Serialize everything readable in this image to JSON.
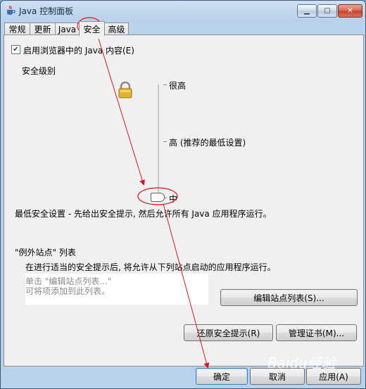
{
  "window": {
    "title": "Java 控制面板"
  },
  "tabs": [
    {
      "label": "常规"
    },
    {
      "label": "更新"
    },
    {
      "label": "Java"
    },
    {
      "label": "安全"
    },
    {
      "label": "高级"
    }
  ],
  "active_tab": "安全",
  "security": {
    "enable_java_label": "启用浏览器中的 Java 内容(E)",
    "enable_java_checked": true,
    "level_heading": "安全级别",
    "levels": [
      {
        "label": "很高"
      },
      {
        "label": "高 (推荐的最低设置)"
      },
      {
        "label": "中"
      }
    ],
    "selected_level": "中",
    "level_description": "最低安全设置 - 先给出安全提示, 然后允许所有 Java 应用程序运行。"
  },
  "exception_sites": {
    "heading": "\"例外站点\" 列表",
    "description": "在进行适当的安全提示后, 将允许从下列站点启动的应用程序运行。",
    "placeholder_line1": "单击 \"编辑站点列表...\"",
    "placeholder_line2": "可将项添加到此列表。",
    "edit_button": "编辑站点列表(S)..."
  },
  "buttons": {
    "restore_prompts": "还原安全提示(R)",
    "manage_certs": "管理证书(M)...",
    "ok": "确定",
    "cancel": "取消",
    "apply": "应用(A)"
  },
  "watermark": "Baidu经验",
  "colors": {
    "annotation": "#e0141e",
    "titlebar": "#b9d1ea"
  },
  "icons": {
    "app": "java-cup-icon",
    "lock": "lock-icon"
  }
}
